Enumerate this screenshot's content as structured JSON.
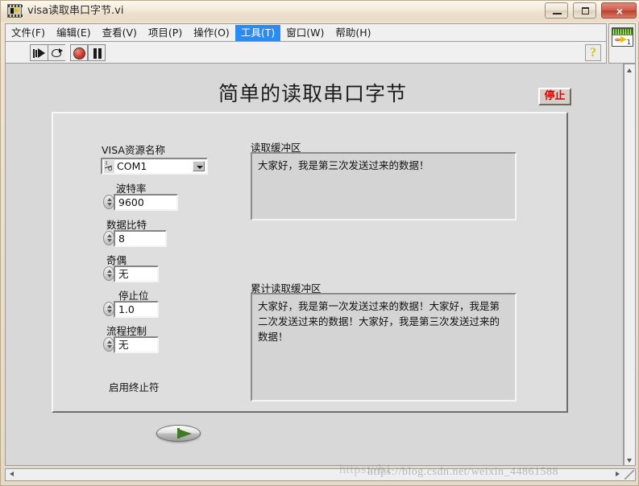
{
  "window": {
    "title": "visa读取串口字节.vi",
    "icon": "labview-vi-icon",
    "buttons": {
      "minimize": "minimize-icon",
      "maximize": "maximize-icon",
      "close": "×"
    }
  },
  "menu": {
    "items": [
      {
        "label": "文件(F)",
        "selected": false
      },
      {
        "label": "编辑(E)",
        "selected": false
      },
      {
        "label": "查看(V)",
        "selected": false
      },
      {
        "label": "项目(P)",
        "selected": false
      },
      {
        "label": "操作(O)",
        "selected": false
      },
      {
        "label": "工具(T)",
        "selected": true
      },
      {
        "label": "窗口(W)",
        "selected": false
      },
      {
        "label": "帮助(H)",
        "selected": false
      }
    ]
  },
  "toolbar": {
    "run": "run-arrow-icon",
    "run_continuously": "run-continuously-icon",
    "abort": "abort-execution-icon",
    "pause": "pause-icon",
    "help": "?",
    "vi_icon_number": "1"
  },
  "front_panel": {
    "title": "简单的读取串口字节",
    "stop_button": "停止",
    "controls": {
      "visa_resource": {
        "label": "VISA资源名称",
        "value": "COM1",
        "glyph_top": "I",
        "glyph_bottom": "O"
      },
      "baud_rate": {
        "label": "波特率",
        "value": "9600"
      },
      "data_bits": {
        "label": "数据比特",
        "value": "8"
      },
      "parity": {
        "label": "奇偶",
        "value": "无"
      },
      "stop_bits": {
        "label": "停止位",
        "value": "1.0"
      },
      "flow_control": {
        "label": "流程控制",
        "value": "无"
      },
      "enable_termination": {
        "label": "启用终止符",
        "state": "on"
      }
    },
    "indicators": {
      "read_buffer": {
        "label": "读取缓冲区",
        "value": "大家好，我是第三次发送过来的数据！"
      },
      "accumulated_read_buffer": {
        "label": "累计读取缓冲区",
        "value": "大家好，我是第一次发送过来的数据！大家好，我是第二次发送过来的数据！大家好，我是第三次发送过来的数据！"
      }
    }
  },
  "watermark": {
    "line1": "https://b1",
    "line2": "https://blog.csdn.net/weixin_44861588"
  },
  "colors": {
    "menu_highlight": "#2a8bf2",
    "stop_text": "#e40000",
    "panel_bg": "#dedede",
    "canvas_bg": "#d8d8d8",
    "abort_red": "#cd3c2e",
    "switch_green": "#3f7a28"
  }
}
